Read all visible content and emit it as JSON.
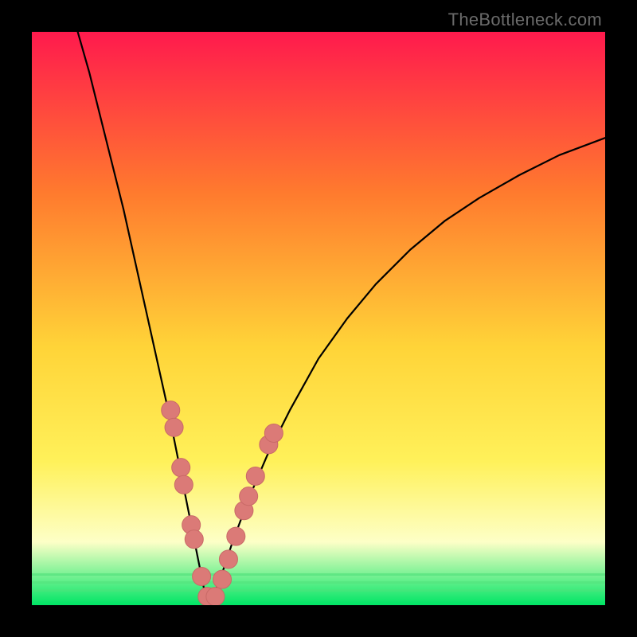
{
  "watermark": {
    "text": "TheBottleneck.com"
  },
  "colors": {
    "black": "#000000",
    "curve": "#000000",
    "marker_fill": "#db7a77",
    "marker_stroke": "#c96a67",
    "grad_top": "#ff1a4d",
    "grad_mid1": "#ff7a2e",
    "grad_mid2": "#ffd438",
    "grad_mid3": "#fff15a",
    "grad_mid4": "#fdffc7",
    "grad_bottom_stripe": "#4fe07a",
    "grad_bottom": "#00e565"
  },
  "chart_data": {
    "type": "line",
    "title": "",
    "xlabel": "",
    "ylabel": "",
    "xlim": [
      0,
      100
    ],
    "ylim": [
      0,
      100
    ],
    "notes": "Abstract bottleneck curve plotted over a vertical red→orange→yellow→green gradient. No axes, ticks, or numeric labels visible; x and y are normalized 0–100 from visual estimation. Two series form a sharp V reaching ~0 near x≈31. Salmon-colored markers highlight points near the trough on both arms.",
    "series": [
      {
        "name": "left_arm",
        "x": [
          8,
          10,
          12,
          14,
          16,
          18,
          20,
          22,
          24,
          26,
          28,
          29,
          30,
          31
        ],
        "y": [
          100,
          93,
          85,
          77,
          69,
          60,
          51,
          42,
          33,
          23,
          13,
          8,
          3,
          0
        ]
      },
      {
        "name": "right_arm",
        "x": [
          31,
          33,
          35,
          38,
          41,
          45,
          50,
          55,
          60,
          66,
          72,
          78,
          85,
          92,
          100
        ],
        "y": [
          0,
          5,
          11,
          19,
          26,
          34,
          43,
          50,
          56,
          62,
          67,
          71,
          75,
          78.5,
          81.5
        ]
      }
    ],
    "markers": [
      {
        "x": 24.2,
        "y": 34
      },
      {
        "x": 24.8,
        "y": 31
      },
      {
        "x": 26.0,
        "y": 24
      },
      {
        "x": 26.5,
        "y": 21
      },
      {
        "x": 27.8,
        "y": 14
      },
      {
        "x": 28.3,
        "y": 11.5
      },
      {
        "x": 29.6,
        "y": 5
      },
      {
        "x": 30.6,
        "y": 1.5
      },
      {
        "x": 32.0,
        "y": 1.5
      },
      {
        "x": 33.2,
        "y": 4.5
      },
      {
        "x": 34.3,
        "y": 8
      },
      {
        "x": 35.6,
        "y": 12
      },
      {
        "x": 37.0,
        "y": 16.5
      },
      {
        "x": 37.8,
        "y": 19
      },
      {
        "x": 39.0,
        "y": 22.5
      },
      {
        "x": 41.3,
        "y": 28
      },
      {
        "x": 42.2,
        "y": 30
      }
    ],
    "marker_radius": 1.6
  }
}
